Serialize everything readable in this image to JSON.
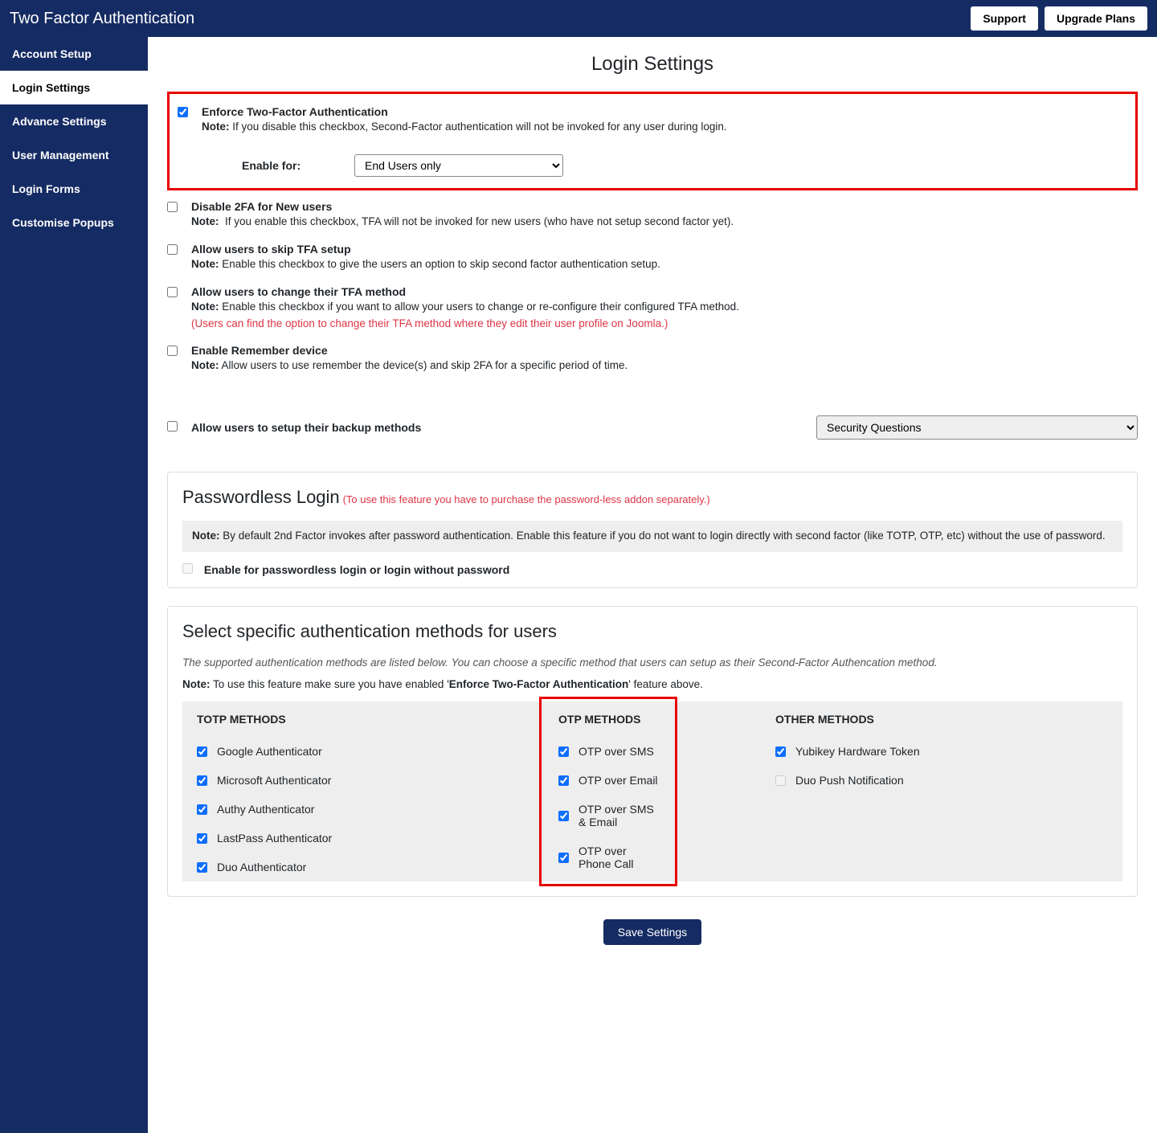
{
  "header": {
    "title": "Two Factor Authentication",
    "support": "Support",
    "upgrade": "Upgrade Plans"
  },
  "sidebar": {
    "items": [
      "Account Setup",
      "Login Settings",
      "Advance Settings",
      "User Management",
      "Login Forms",
      "Customise Popups"
    ],
    "active_index": 1
  },
  "page": {
    "title": "Login Settings"
  },
  "opts": {
    "enforce": {
      "label": "Enforce Two-Factor Authentication",
      "note_label": "Note:",
      "note": "If you disable this checkbox, Second-Factor authentication will not be invoked for any user during login.",
      "enable_for_label": "Enable for:",
      "enable_for_value": "End Users only"
    },
    "disable_new": {
      "label": "Disable 2FA for New users",
      "note_label": "Note:",
      "note": "If you enable this checkbox, TFA will not be invoked for new users (who have not setup second factor yet)."
    },
    "skip": {
      "label": "Allow users to skip TFA setup",
      "note_label": "Note:",
      "note": "Enable this checkbox to give the users an option to skip second factor authentication setup."
    },
    "change_method": {
      "label": "Allow users to change their TFA method",
      "note_label": "Note:",
      "note": "Enable this checkbox if you want to allow your users to change or re-configure their configured TFA method.",
      "hint": "(Users can find the option to change their TFA method where they edit their user profile on Joomla.)"
    },
    "remember": {
      "label": "Enable Remember device",
      "note_label": "Note:",
      "note": "Allow users to use remember the device(s) and skip 2FA for a specific period of time."
    },
    "backup": {
      "label": "Allow users to setup their backup methods",
      "value": "Security Questions"
    }
  },
  "passwordless": {
    "heading": "Passwordless Login",
    "red": "(To use this feature you have to purchase the password-less addon separately.)",
    "note_label": "Note:",
    "note": "By default 2nd Factor invokes after password authentication. Enable this feature if you do not want to login directly with second factor (like TOTP, OTP, etc) without the use of password.",
    "checkbox_label": "Enable for passwordless login or login without password"
  },
  "methods": {
    "heading": "Select specific authentication methods for users",
    "desc": "The supported authentication methods are listed below. You can choose a specific method that users can setup as their Second-Factor Authencation method.",
    "note_prefix": "Note:",
    "note_before": "To use this feature make sure you have enabled '",
    "note_bold": "Enforce Two-Factor Authentication",
    "note_after": "' feature above.",
    "cols": {
      "totp": {
        "head": "TOTP METHODS",
        "items": [
          "Google Authenticator",
          "Microsoft Authenticator",
          "Authy Authenticator",
          "LastPass Authenticator",
          "Duo Authenticator"
        ]
      },
      "otp": {
        "head": "OTP METHODS",
        "items": [
          "OTP over SMS",
          "OTP over Email",
          "OTP over SMS & Email",
          "OTP over Phone Call"
        ]
      },
      "other": {
        "head": "OTHER METHODS",
        "items": [
          "Yubikey Hardware Token",
          "Duo Push Notification"
        ]
      }
    }
  },
  "save": "Save Settings"
}
